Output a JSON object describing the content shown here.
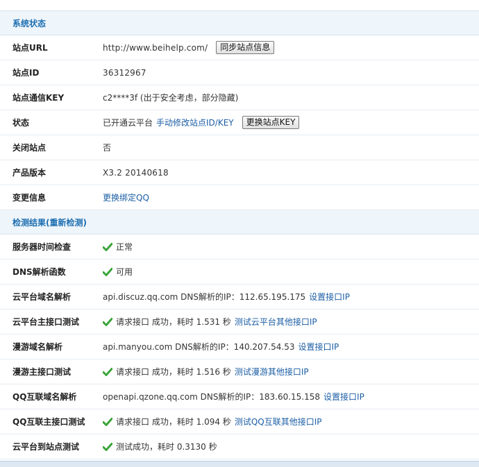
{
  "system_status": {
    "header": "系统状态",
    "rows": [
      {
        "label": "站点URL",
        "value": "http://www.beihelp.com/",
        "button": "同步站点信息"
      },
      {
        "label": "站点ID",
        "value": "36312967"
      },
      {
        "label": "站点通信KEY",
        "value": "c2****3f (出于安全考虑，部分隐藏)"
      },
      {
        "label": "状态",
        "value": "已开通云平台",
        "link": "手动修改站点ID/KEY",
        "button": "更换站点KEY"
      },
      {
        "label": "关闭站点",
        "value": "否"
      },
      {
        "label": "产品版本",
        "value": "X3.2 20140618"
      },
      {
        "label": "变更信息",
        "link": "更换绑定QQ"
      }
    ]
  },
  "check_results": {
    "header": "检测结果(重新检测)",
    "rows": [
      {
        "label": "服务器时间检查",
        "value": "正常",
        "check": true
      },
      {
        "label": "DNS解析函数",
        "value": "可用",
        "check": true
      },
      {
        "label": "云平台域名解析",
        "value": "api.discuz.qq.com DNS解析的IP：112.65.195.175",
        "link": "设置接口IP"
      },
      {
        "label": "云平台主接口测试",
        "value": "请求接口 成功，耗时 1.531 秒",
        "link": "测试云平台其他接口IP",
        "check": true
      },
      {
        "label": "漫游域名解析",
        "value": "api.manyou.com DNS解析的IP：140.207.54.53",
        "link": "设置接口IP"
      },
      {
        "label": "漫游主接口测试",
        "value": "请求接口 成功，耗时 1.516 秒",
        "link": "测试漫游其他接口IP",
        "check": true
      },
      {
        "label": "QQ互联域名解析",
        "value": "openapi.qzone.qq.com DNS解析的IP：183.60.15.158",
        "link": "设置接口IP"
      },
      {
        "label": "QQ互联主接口测试",
        "value": "请求接口 成功，耗时 1.094 秒",
        "link": "测试QQ互联其他接口IP",
        "check": true
      },
      {
        "label": "云平台到站点测试",
        "value": "测试成功，耗时 0.3130 秒",
        "check": true
      }
    ]
  },
  "colors": {
    "accent": "#1e6fb1",
    "link": "#1c5ea5",
    "header_bg": "#eef5fb",
    "check_green": "#3aa43a"
  },
  "icons": {
    "check": "check-icon"
  }
}
